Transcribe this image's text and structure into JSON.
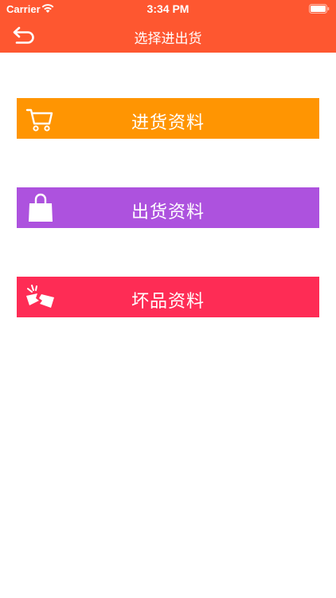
{
  "status_bar": {
    "carrier": "Carrier",
    "time": "3:34 PM"
  },
  "nav": {
    "title": "选择进出货",
    "back_icon": "back-arrow-icon",
    "bg_color": "#fe5730"
  },
  "menu": [
    {
      "label": "进货资料",
      "icon": "shopping-cart-icon",
      "color": "#ff9502"
    },
    {
      "label": "出货资料",
      "icon": "shopping-bag-icon",
      "color": "#ad52de"
    },
    {
      "label": "坏品资料",
      "icon": "broken-item-icon",
      "color": "#fe2c55"
    }
  ]
}
